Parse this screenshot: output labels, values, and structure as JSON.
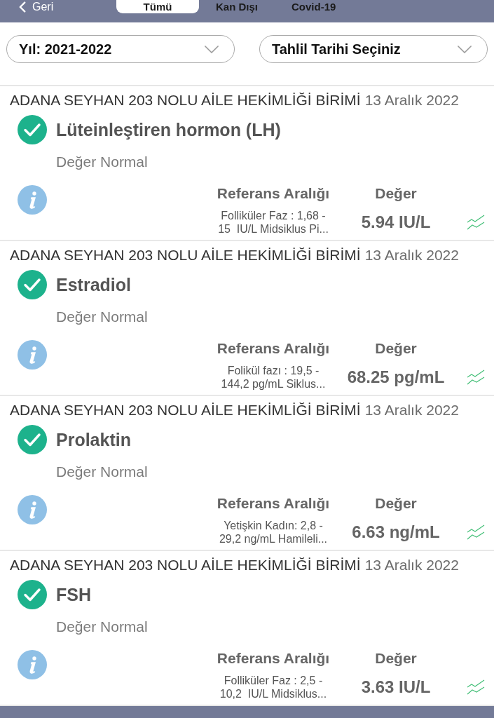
{
  "header": {
    "back_label": "Geri",
    "tabs": [
      {
        "label": "Tümü",
        "selected": true
      },
      {
        "label": "Kan Dışı",
        "selected": false
      },
      {
        "label": "Covid-19",
        "selected": false
      }
    ]
  },
  "filters": [
    {
      "label": "Yıl: 2021-2022"
    },
    {
      "label": "Tahlil Tarihi Seçiniz"
    }
  ],
  "results": [
    {
      "facility": "ADANA SEYHAN 203 NOLU AİLE HEKİMLİĞİ BİRİMİ",
      "date": "13 Aralık 2022",
      "test": "Lüteinleştiren hormon (LH)",
      "normal": true,
      "status": "Değer Normal",
      "reference_label": "Referans Aralığı",
      "reference": "Folliküler Faz : 1,68 - 15  IU/L Midsiklus Pi...",
      "value_label": "Değer",
      "value": "5.94 IU/L"
    },
    {
      "facility": "ADANA SEYHAN 203 NOLU AİLE HEKİMLİĞİ BİRİMİ",
      "date": "13 Aralık 2022",
      "test": "Estradiol",
      "normal": true,
      "status": "Değer Normal",
      "reference_label": "Referans Aralığı",
      "reference": "Folikül fazı : 19,5 - 144,2 pg/mL Siklus...",
      "value_label": "Değer",
      "value": "68.25 pg/mL"
    },
    {
      "facility": "ADANA SEYHAN 203 NOLU AİLE HEKİMLİĞİ BİRİMİ",
      "date": "13 Aralık 2022",
      "test": "Prolaktin",
      "normal": true,
      "status": "Değer Normal",
      "reference_label": "Referans Aralığı",
      "reference": "Yetişkin Kadın: 2,8 - 29,2 ng/mL Hamileli...",
      "value_label": "Değer",
      "value": "6.63 ng/mL"
    },
    {
      "facility": "ADANA SEYHAN 203 NOLU AİLE HEKİMLİĞİ BİRİMİ",
      "date": "13 Aralık 2022",
      "test": "FSH",
      "normal": true,
      "status": "Değer Normal",
      "reference_label": "Referans Aralığı",
      "reference": "Folliküler Faz : 2,5 - 10,2  IU/L Midsiklus...",
      "value_label": "Değer",
      "value": "3.63 IU/L"
    }
  ]
}
